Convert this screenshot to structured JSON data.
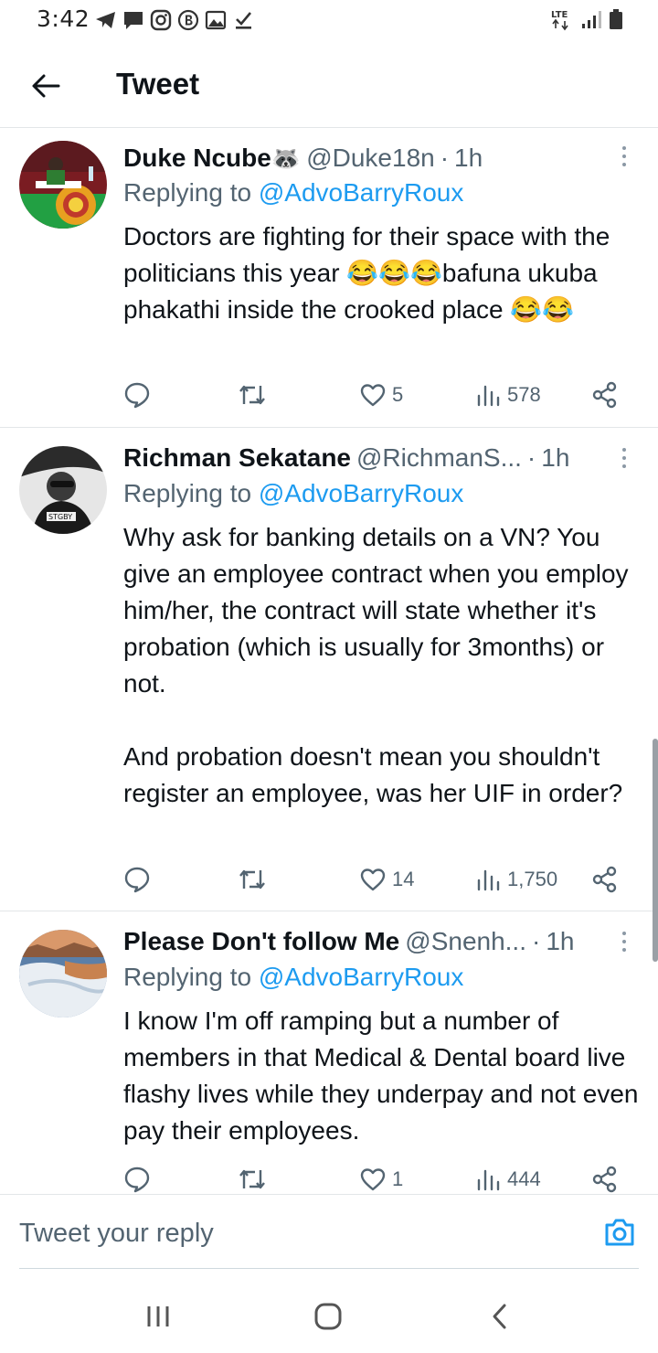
{
  "status_bar": {
    "time": "3:42",
    "network": "LTE"
  },
  "header": {
    "title": "Tweet"
  },
  "tweets": [
    {
      "name": "Duke Ncube",
      "name_emoji": "🦝",
      "handle": "@Duke18n",
      "time": "1h",
      "replying_prefix": "Replying to ",
      "replying_to": "@AdvoBarryRoux",
      "text": "Doctors are fighting for their space with the politicians this year 😂😂😂bafuna ukuba phakathi inside the crooked place 😂😂",
      "likes": "5",
      "views": "578"
    },
    {
      "name": "Richman Sekatane",
      "handle": "@RichmanS...",
      "time": "1h",
      "replying_prefix": "Replying to ",
      "replying_to": "@AdvoBarryRoux",
      "text": "Why ask for banking details on a VN? You give an employee contract when you employ him/her, the contract will state whether it's probation (which is usually for 3months) or not.\n\nAnd probation doesn't mean you shouldn't register an employee, was her UIF in order?",
      "likes": "14",
      "views": "1,750"
    },
    {
      "name": "Please Don't follow Me",
      "handle": "@Snenh...",
      "time": "1h",
      "replying_prefix": "Replying to ",
      "replying_to": "@AdvoBarryRoux",
      "text": "I know I'm off ramping but a number of members in that Medical & Dental board live flashy lives while they underpay and not even pay their employees.",
      "likes": "1",
      "views": "444"
    }
  ],
  "reply_bar": {
    "placeholder": "Tweet your reply"
  },
  "colors": {
    "accent": "#1d9bf0",
    "secondary_text": "#536471",
    "divider": "#e3e6e8"
  },
  "icons": [
    "back-arrow-icon",
    "comment-icon",
    "retweet-icon",
    "heart-icon",
    "views-icon",
    "share-icon",
    "camera-icon",
    "more-icon"
  ]
}
